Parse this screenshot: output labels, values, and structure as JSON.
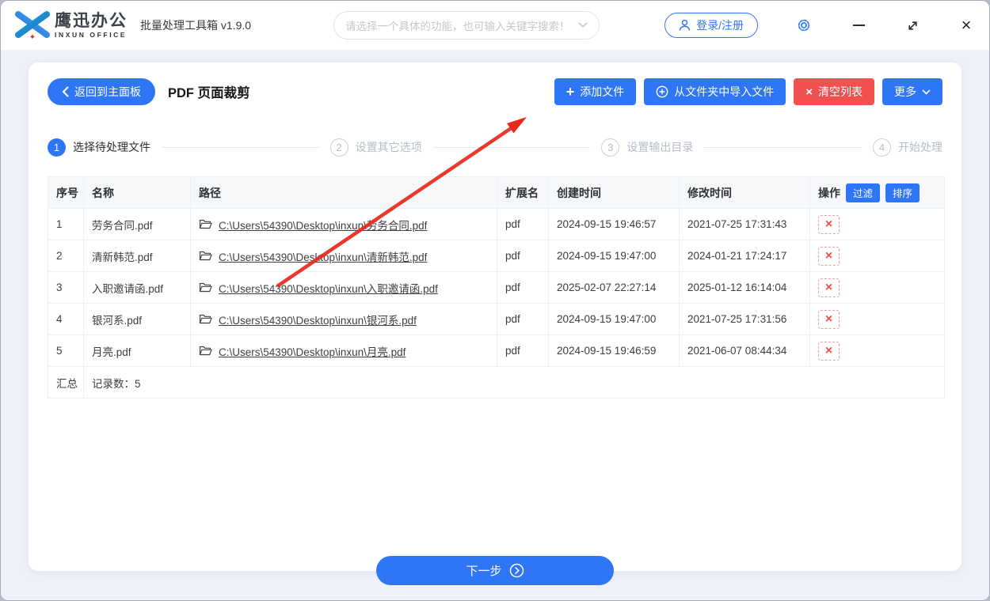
{
  "header": {
    "logo": {
      "brand": "鹰迅办公",
      "brand_sub": "INXUN OFFICE"
    },
    "app_title": "批量处理工具箱 v1.9.0",
    "search_placeholder": "请选择一个具体的功能，也可输入关键字搜索！",
    "login_label": "登录/注册"
  },
  "icons": {
    "minimize": "",
    "close": "×",
    "delete": "×",
    "plus": "+",
    "clear": "×"
  },
  "toolbar": {
    "back_label": "返回到主面板",
    "page_title": "PDF 页面裁剪",
    "add_files_label": "添加文件",
    "import_folder_label": "从文件夹中导入文件",
    "clear_list_label": "清空列表",
    "more_label": "更多"
  },
  "steps": [
    {
      "num": "1",
      "label": "选择待处理文件"
    },
    {
      "num": "2",
      "label": "设置其它选项"
    },
    {
      "num": "3",
      "label": "设置输出目录"
    },
    {
      "num": "4",
      "label": "开始处理"
    }
  ],
  "table": {
    "headers": [
      "序号",
      "名称",
      "路径",
      "扩展名",
      "创建时间",
      "修改时间",
      "操作"
    ],
    "filter_label": "过滤",
    "sort_label": "排序",
    "rows": [
      {
        "index": "1",
        "name": "劳务合同.pdf",
        "path": "C:\\Users\\54390\\Desktop\\inxun\\劳务合同.pdf",
        "ext": "pdf",
        "created": "2024-09-15 19:46:57",
        "modified": "2021-07-25 17:31:43"
      },
      {
        "index": "2",
        "name": "清新韩范.pdf",
        "path": "C:\\Users\\54390\\Desktop\\inxun\\清新韩范.pdf",
        "ext": "pdf",
        "created": "2024-09-15 19:47:00",
        "modified": "2024-01-21 17:24:17"
      },
      {
        "index": "3",
        "name": "入职邀请函.pdf",
        "path": "C:\\Users\\54390\\Desktop\\inxun\\入职邀请函.pdf",
        "ext": "pdf",
        "created": "2025-02-07 22:27:14",
        "modified": "2025-01-12 16:14:04"
      },
      {
        "index": "4",
        "name": "银河系.pdf",
        "path": "C:\\Users\\54390\\Desktop\\inxun\\银河系.pdf",
        "ext": "pdf",
        "created": "2024-09-15 19:47:00",
        "modified": "2021-07-25 17:31:56"
      },
      {
        "index": "5",
        "name": "月亮.pdf",
        "path": "C:\\Users\\54390\\Desktop\\inxun\\月亮.pdf",
        "ext": "pdf",
        "created": "2024-09-15 19:46:59",
        "modified": "2021-06-07 08:44:34"
      }
    ],
    "summary_label": "汇总",
    "summary_value": "记录数：5"
  },
  "footer": {
    "next_label": "下一步"
  },
  "colors": {
    "primary": "#2f76f6",
    "danger": "#f05050",
    "arrow": "#e8281a",
    "background": "#eef1fa"
  }
}
